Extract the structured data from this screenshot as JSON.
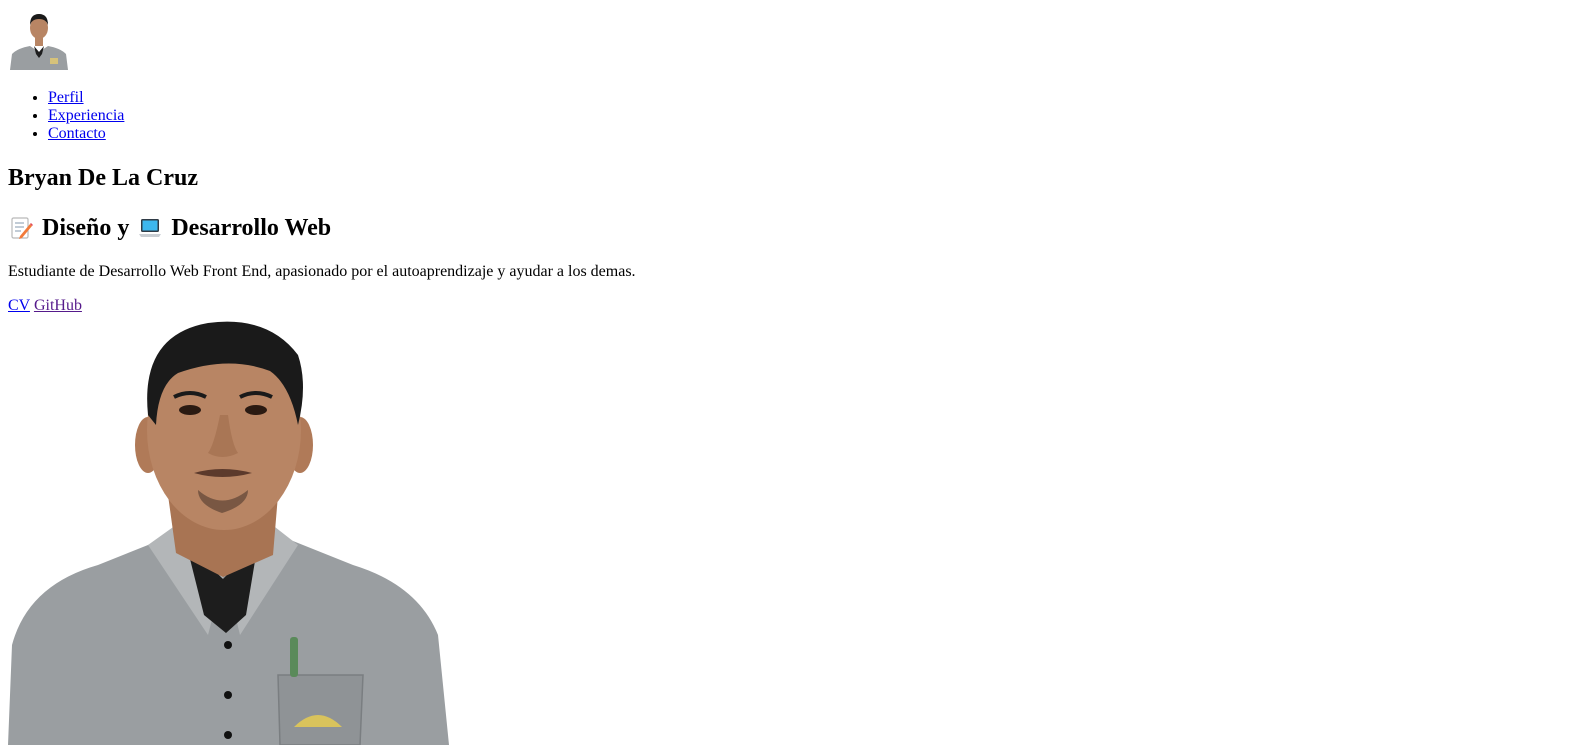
{
  "header": {
    "nav": [
      {
        "label": "Perfil"
      },
      {
        "label": "Experiencia"
      },
      {
        "label": "Contacto"
      }
    ]
  },
  "profile": {
    "name": "Bryan De La Cruz",
    "role_part1": "Diseño y",
    "role_part2": "Desarrollo Web",
    "role_icons": [
      "memo-icon",
      "laptop-icon"
    ],
    "bio": "Estudiante de Desarrollo Web Front End, apasionado por el autoaprendizaje y ayudar a los demas.",
    "links": [
      {
        "label": "CV"
      },
      {
        "label": "GitHub"
      }
    ]
  },
  "colors": {
    "link": "#0000ee",
    "visited_link": "#551a8b",
    "shirt": "#9a9ea1",
    "skin": "#b88564",
    "hair": "#1a1a1a"
  }
}
